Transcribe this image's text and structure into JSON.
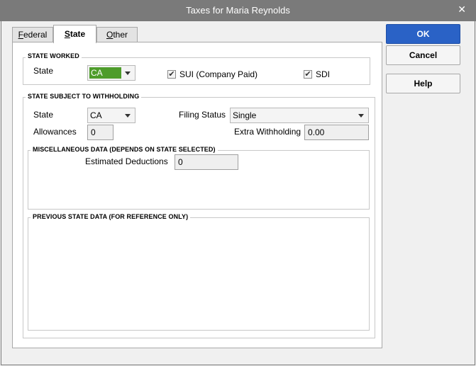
{
  "window": {
    "title": "Taxes for Maria Reynolds",
    "close_glyph": "✕"
  },
  "tabs": [
    {
      "label": "Federal",
      "mnemonic": "F",
      "rest": "ederal",
      "active": false
    },
    {
      "label": "State",
      "mnemonic": "S",
      "rest": "tate",
      "active": true
    },
    {
      "label": "Other",
      "mnemonic": "O",
      "rest": "ther",
      "active": false
    }
  ],
  "state_worked": {
    "heading": "STATE WORKED",
    "state_label": "State",
    "state_value": "CA",
    "sui_label": "SUI (Company Paid)",
    "sui_checked": true,
    "sdi_label": "SDI",
    "sdi_checked": true
  },
  "withholding": {
    "heading": "STATE SUBJECT TO WITHHOLDING",
    "state_label": "State",
    "state_value": "CA",
    "filing_status_label": "Filing Status",
    "filing_status_value": "Single",
    "allowances_label": "Allowances",
    "allowances_value": "0",
    "extra_withholding_label": "Extra Withholding",
    "extra_withholding_value": "0.00"
  },
  "misc": {
    "heading": "MISCELLANEOUS DATA (DEPENDS ON STATE SELECTED)",
    "estimated_deductions_label": "Estimated Deductions",
    "estimated_deductions_value": "0"
  },
  "previous": {
    "heading": "PREVIOUS STATE DATA (FOR REFERENCE ONLY)"
  },
  "buttons": {
    "ok": "OK",
    "cancel": "Cancel",
    "help": "Help"
  },
  "check_glyph": "✔",
  "colors": {
    "titlebar": "#7a7a7a",
    "ok_button": "#2a62c6",
    "state_highlight": "#4e9c2b"
  }
}
